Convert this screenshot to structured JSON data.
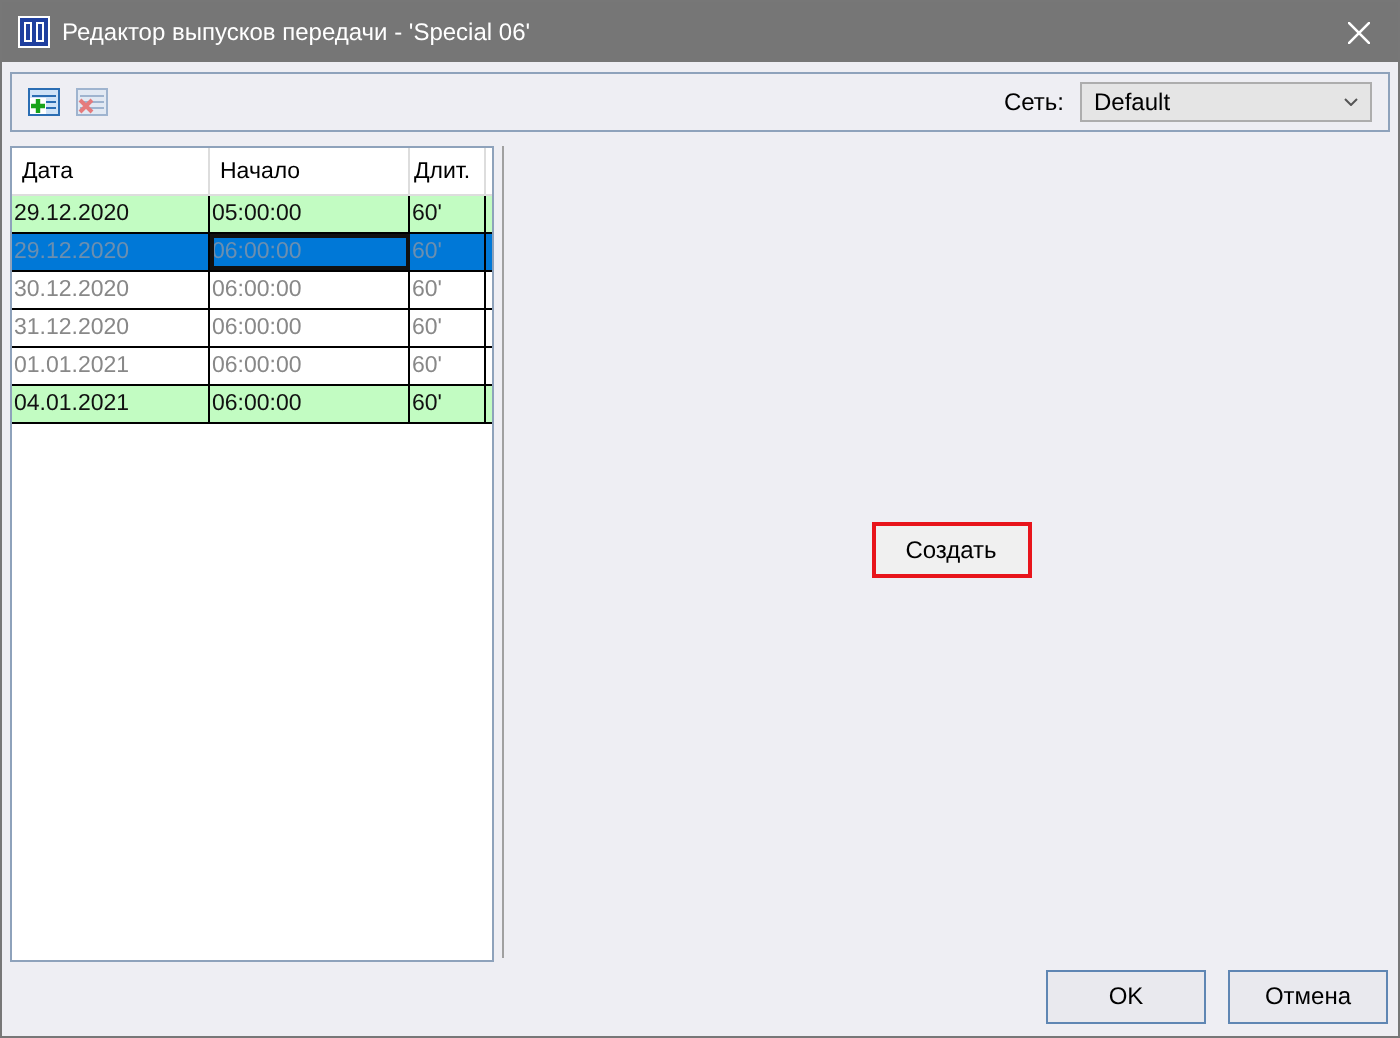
{
  "window": {
    "title": "Редактор выпусков передачи - 'Special 06'"
  },
  "toolbar": {
    "network_label": "Сеть:",
    "network": "Default"
  },
  "table": {
    "columns": [
      "Дата",
      "Начало",
      "Длит."
    ],
    "rows": [
      {
        "cells": [
          "29.12.2020",
          "05:00:00",
          "60'"
        ],
        "highlighted": true,
        "selected": false
      },
      {
        "cells": [
          "29.12.2020",
          "06:00:00",
          "60'"
        ],
        "highlighted": false,
        "selected": true
      },
      {
        "cells": [
          "30.12.2020",
          "06:00:00",
          "60'"
        ],
        "highlighted": false,
        "selected": false
      },
      {
        "cells": [
          "31.12.2020",
          "06:00:00",
          "60'"
        ],
        "highlighted": false,
        "selected": false
      },
      {
        "cells": [
          "01.01.2021",
          "06:00:00",
          "60'"
        ],
        "highlighted": false,
        "selected": false
      },
      {
        "cells": [
          "04.01.2021",
          "06:00:00",
          "60'"
        ],
        "highlighted": true,
        "selected": false
      }
    ]
  },
  "create_button": "Создать",
  "buttons": [
    "OK",
    "Отмена"
  ]
}
